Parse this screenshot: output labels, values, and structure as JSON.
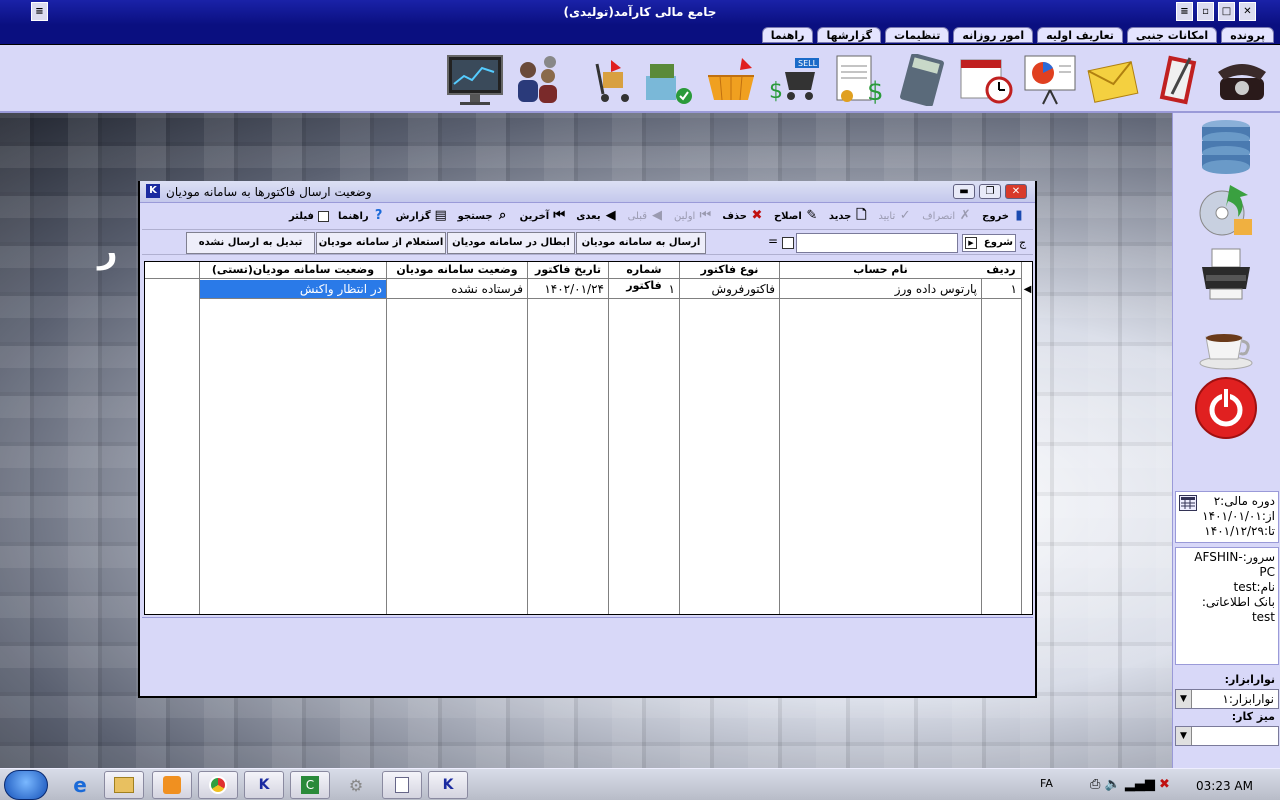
{
  "app": {
    "title": "جامع مالی کارآمد(تولیدی)"
  },
  "menu": [
    "پرونده",
    "امکانات جنبی",
    "تعاریف اولیه",
    "امور روزانه",
    "تنظیمات",
    "گزارشها",
    "راهنما"
  ],
  "toolbar_icons": [
    "server-dashboard-icon",
    "users-icon",
    "cart-trolley-icon",
    "hardware-icon",
    "basket-icon",
    "sell-cart-icon",
    "invoice-icon",
    "calculator-icon",
    "calendar-clock-icon",
    "presentation-chart-icon",
    "mail-icon",
    "notebook-icon",
    "telephone-icon"
  ],
  "side_icons": [
    "database-icon",
    "backup-disc-icon",
    "printer-icon",
    "coffee-icon",
    "power-icon"
  ],
  "sidebar": {
    "period": "دوره مالی:۲",
    "from": "از:۱۴۰۱/۰۱/۰۱",
    "to": "تا:۱۴۰۱/۱۲/۲۹",
    "server": "سرور:AFSHIN-PC",
    "name": "نام:test",
    "db_label": "بانک اطلاعاتی:",
    "db_value": "test",
    "toolbar_label": "نوارابزار:",
    "toolbar_value": "نوارابزار:۱",
    "desk_label": "میز کار:",
    "desk_value": ""
  },
  "window": {
    "title": "وضعیت ارسال فاکتورها به سامانه مودیان",
    "toolbar": [
      {
        "label": "خروج",
        "icon": "exit-icon",
        "enabled": true
      },
      {
        "label": "انصراف",
        "icon": "cancel-icon",
        "enabled": false
      },
      {
        "label": "تایید",
        "icon": "check-icon",
        "enabled": false
      },
      {
        "label": "جدید",
        "icon": "new-icon",
        "enabled": true
      },
      {
        "label": "اصلاح",
        "icon": "edit-icon",
        "enabled": true
      },
      {
        "label": "حذف",
        "icon": "delete-icon",
        "enabled": true
      },
      {
        "label": "اولین",
        "icon": "first-icon",
        "enabled": false
      },
      {
        "label": "قبلی",
        "icon": "prev-icon",
        "enabled": false
      },
      {
        "label": "بعدی",
        "icon": "next-icon",
        "enabled": true
      },
      {
        "label": "آخرین",
        "icon": "last-icon",
        "enabled": true
      },
      {
        "label": "جستجو",
        "icon": "search-icon",
        "enabled": true
      },
      {
        "label": "گزارش",
        "icon": "report-icon",
        "enabled": true
      },
      {
        "label": "راهنما",
        "icon": "help-icon",
        "enabled": true
      }
    ],
    "filter_label": "فیلتر",
    "search_label": "شروع",
    "eq": "=",
    "actions": [
      "ارسال به سامانه مودیان",
      "ابطال در سامانه مودیان",
      "استعلام از سامانه مودیان",
      "تبدیل به ارسال نشده"
    ],
    "grid": {
      "columns": [
        "ردیف",
        "نام حساب",
        "نوع فاکتور",
        "شماره فاکتور",
        "تاریخ فاکتور",
        "وضعیت سامانه مودیان",
        "وضعیت سامانه مودیان(تستی)"
      ],
      "rows": [
        [
          "۱",
          "پارتوس داده ورز",
          "فاکتورفروش",
          "۱",
          "۱۴۰۲/۰۱/۲۴",
          "فرستاده نشده",
          "در انتظار واکنش"
        ]
      ]
    }
  },
  "taskbar": {
    "lang": "FA",
    "time": "03:23 AM"
  }
}
